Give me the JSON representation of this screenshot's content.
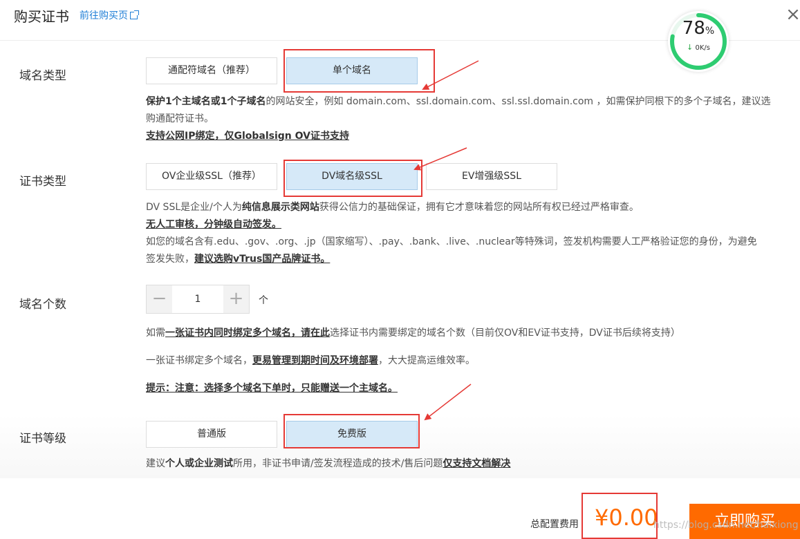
{
  "header": {
    "title": "购买证书",
    "buy_page_link": "前往购买页"
  },
  "speed_widget": {
    "percent": "78",
    "percent_unit": "%",
    "rate": "0K/s",
    "progress": 0.78,
    "color": "#2ecc71"
  },
  "domain_type": {
    "label": "域名类型",
    "options": [
      "通配符域名（推荐）",
      "单个域名"
    ],
    "selected": "单个域名",
    "desc_bold": "保护1个主域名或1个子域名",
    "desc_line1": "的网站安全，例如 domain.com、ssl.domain.com、ssl.ssl.domain.com ，如需保护同根下的多个子域名，建议选",
    "desc_line2": "购通配符证书。",
    "desc_link": "支持公网IP绑定，仅Globalsign OV证书支持"
  },
  "cert_type": {
    "label": "证书类型",
    "options": [
      "OV企业级SSL（推荐）",
      "DV域名级SSL",
      "EV增强级SSL"
    ],
    "selected": "DV域名级SSL",
    "desc_a": "DV SSL是企业/个人为",
    "desc_a_bold": "纯信息展示类网站",
    "desc_a_rest": "获得公信力的基础保证，拥有它才意味着您的网站所有权已经过严格审查。",
    "desc_b": "无人工审核，分钟级自动签发。",
    "desc_c": "如您的域名含有.edu、.gov、.org、.jp（国家缩写）、.pay、.bank、.live、.nuclear等特殊词，签发机构需要人工严格验证您的身份，为避免",
    "desc_d": "签发失败，",
    "desc_d_link": "建议选购vTrus国产品牌证书。"
  },
  "domain_count": {
    "label": "域名个数",
    "value": "1",
    "unit": "个",
    "note1_pre": "如需",
    "note1_link": "一张证书内同时绑定多个域名，请在此",
    "note1_rest": "选择证书内需要绑定的域名个数（目前仅OV和EV证书支持，DV证书后续将支持）",
    "note2_pre": "一张证书绑定多个域名，",
    "note2_link": "更易管理到期时间及环境部署",
    "note2_rest": "，大大提高运维效率。",
    "tip": "提示：注意：选择多个域名下单时，只能赠送一个主域名。"
  },
  "cert_level": {
    "label": "证书等级",
    "options": [
      "普通版",
      "免费版"
    ],
    "selected": "免费版",
    "desc_pre": "建议",
    "desc_bold": "个人或企业测试",
    "desc_mid": "所用，非证书申请/签发流程造成的技术/售后问题",
    "desc_link": "仅支持文档解决"
  },
  "footer": {
    "total_label": "总配置费用",
    "price": "¥0.00",
    "buy_button": "立即购买",
    "watermark": "https://blog.csdn.net/haixiong"
  },
  "colors": {
    "accent": "#ff6a00",
    "link": "#1e7ed6",
    "selected_bg": "#d6e9f8",
    "annotation_red": "#e53935"
  }
}
